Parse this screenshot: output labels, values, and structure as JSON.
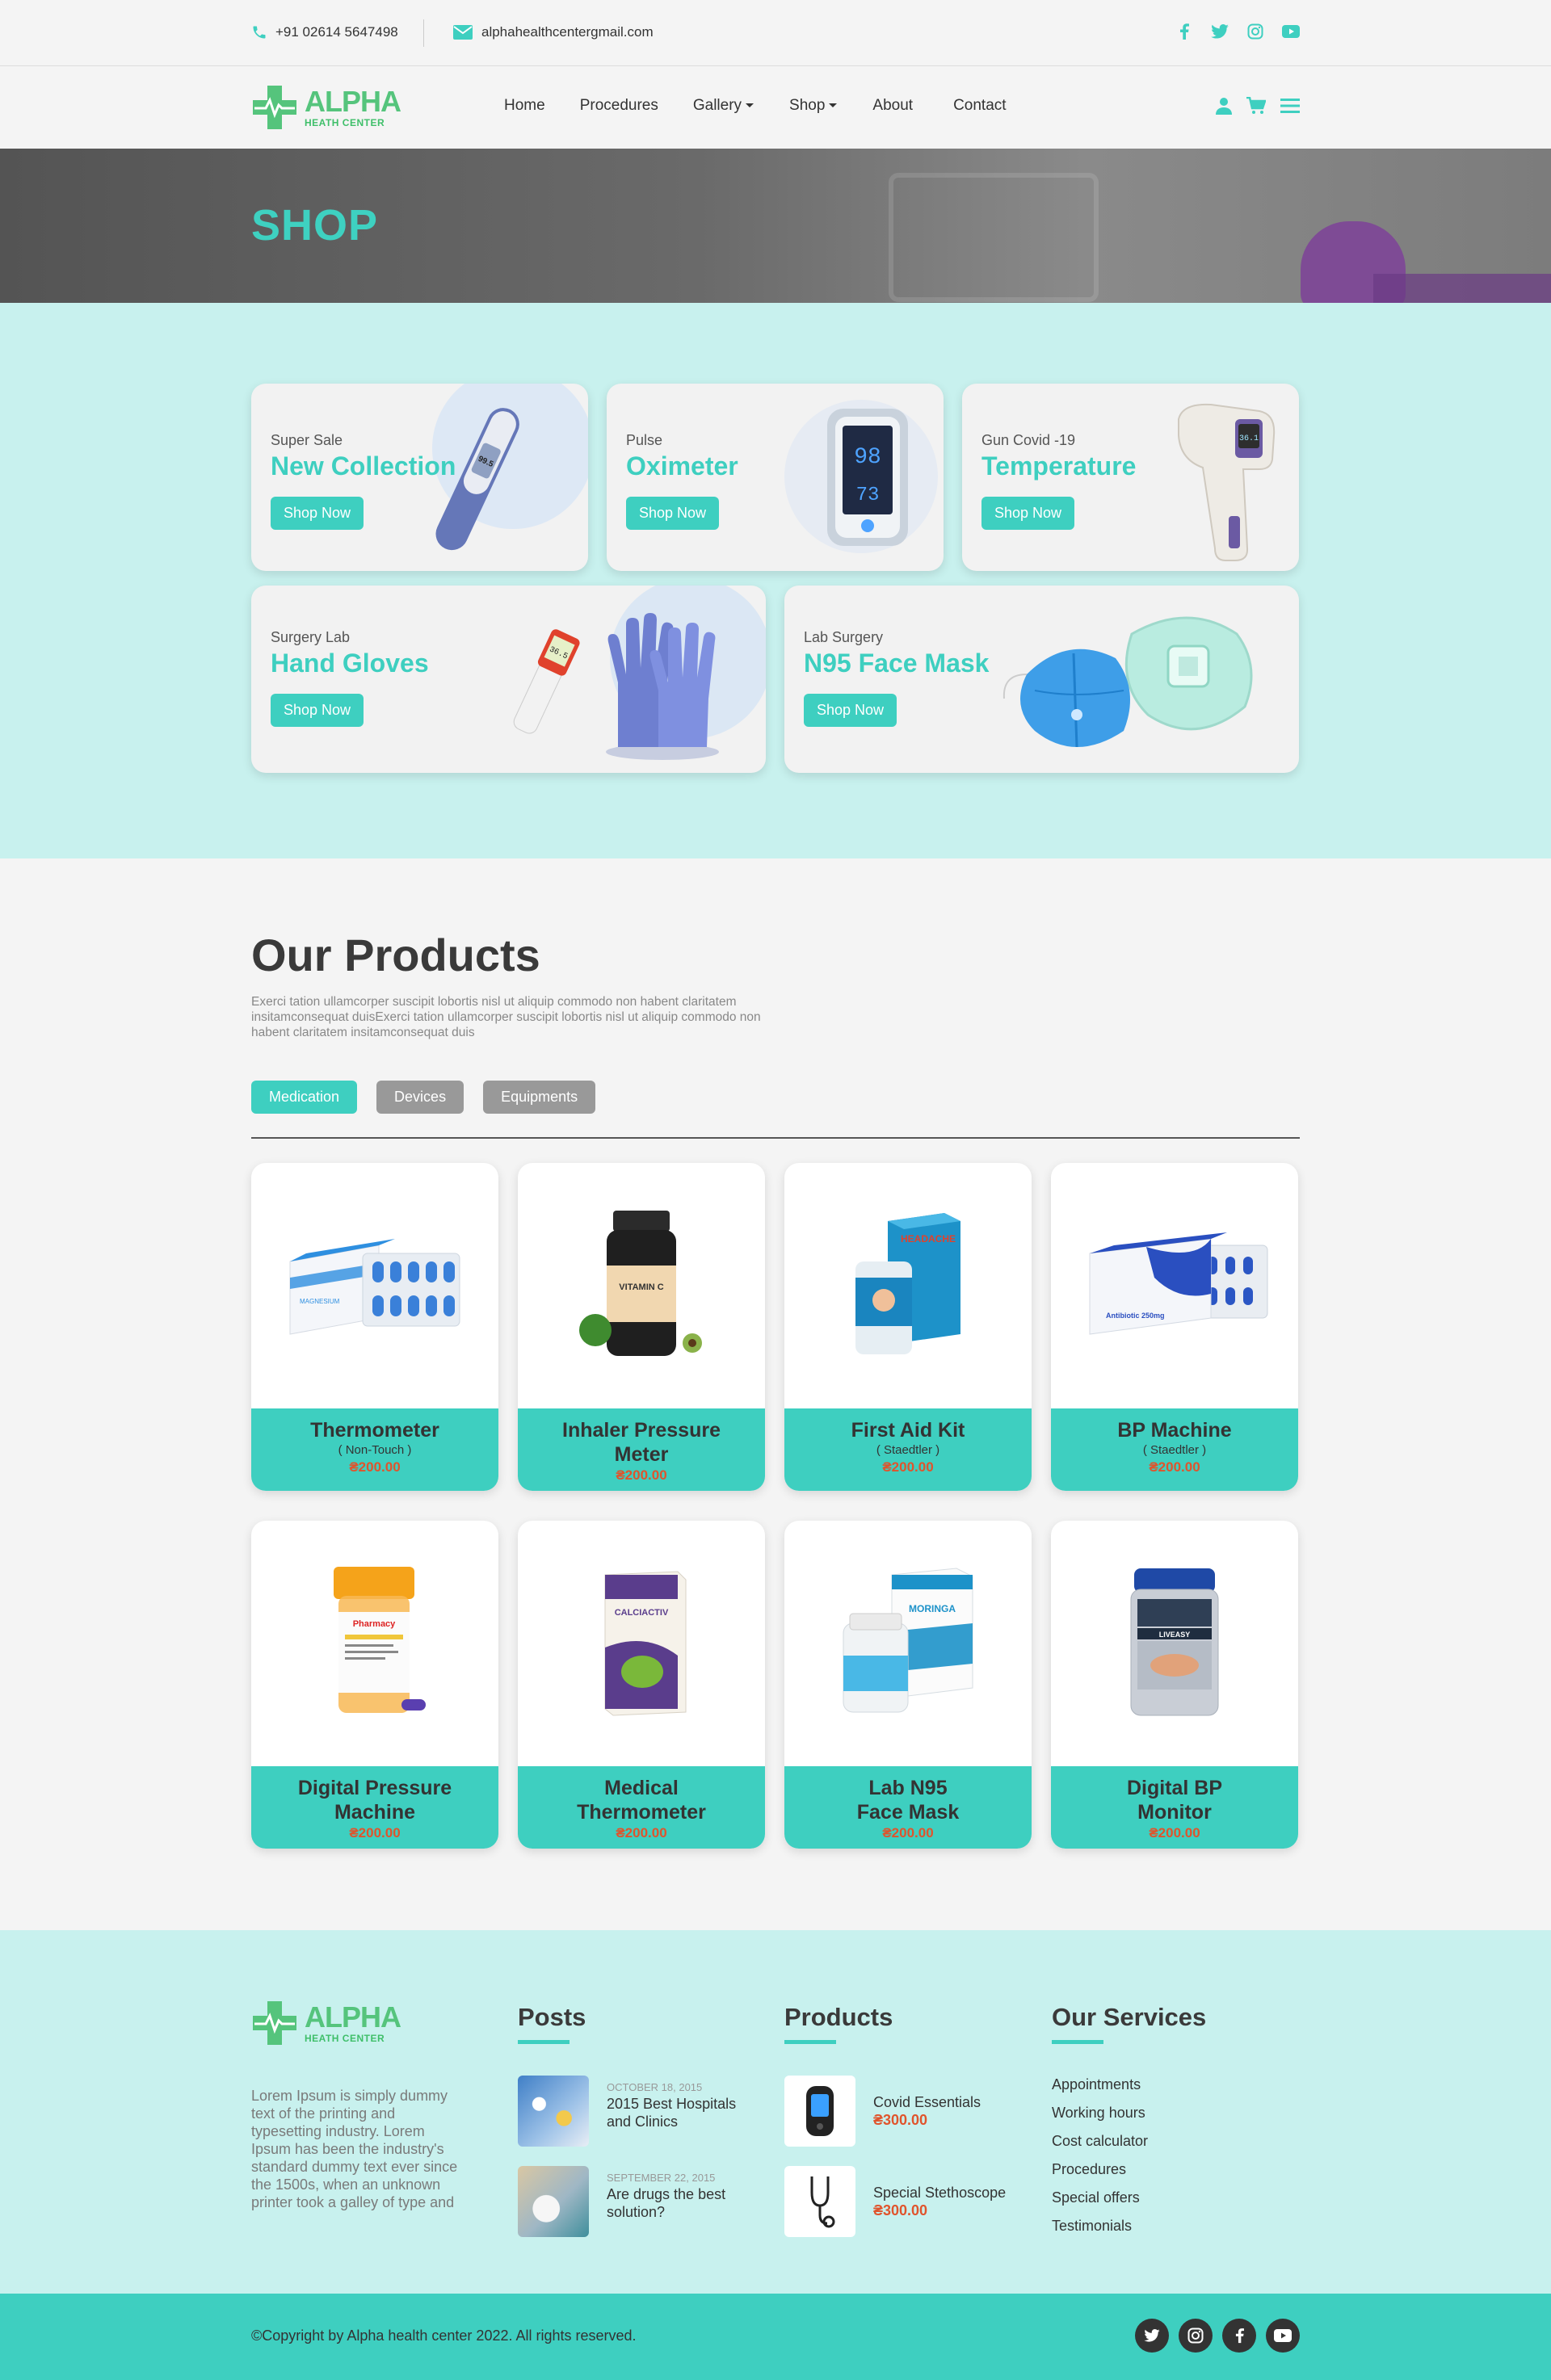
{
  "topbar": {
    "phone": "+91 02614 5647498",
    "email": "alphahealthcentergmail.com",
    "socials": [
      "facebook-icon",
      "twitter-icon",
      "instagram-icon",
      "youtube-icon"
    ]
  },
  "brand": {
    "name": "ALPHA",
    "tagline": "HEATH CENTER"
  },
  "nav": {
    "home": "Home",
    "procedures": "Procedures",
    "gallery": "Gallery",
    "shop": "Shop",
    "about": "About",
    "contact": "Contact"
  },
  "hero": {
    "title": "SHOP"
  },
  "promos": [
    {
      "sub": "Super Sale",
      "title": "New Collection",
      "button": "Shop Now",
      "display": "99.5"
    },
    {
      "sub": "Pulse",
      "title": "Oximeter",
      "button": "Shop Now",
      "display_top": "98",
      "display_bottom": "73"
    },
    {
      "sub": "Gun Covid -19",
      "title": "Temperature",
      "button": "Shop Now",
      "display": "36.1"
    },
    {
      "sub": "Surgery Lab",
      "title": "Hand Gloves",
      "button": "Shop Now",
      "display": "36.5"
    },
    {
      "sub": "Lab Surgery",
      "title": "N95 Face Mask",
      "button": "Shop Now"
    }
  ],
  "products_section": {
    "heading": "Our Products",
    "description": "Exerci tation ullamcorper suscipit lobortis nisl ut aliquip commodo non habent claritatem insitamconsequat duisExerci tation ullamcorper suscipit lobortis nisl ut aliquip commodo non habent claritatem insitamconsequat duis",
    "filters": [
      "Medication",
      "Devices",
      "Equipments"
    ]
  },
  "products": [
    {
      "name": "Thermometer",
      "sub": "( Non-Touch )",
      "price": "₴200.00",
      "pack_label": "MAGNESIUM"
    },
    {
      "name": "Inhaler Pressure Meter",
      "sub": "",
      "price": "₴200.00",
      "pack_label": "VITAMIN C"
    },
    {
      "name": "First Aid Kit",
      "sub": "( Staedtler )",
      "price": "₴200.00",
      "pack_label": "HEADACHE"
    },
    {
      "name": "BP Machine",
      "sub": "( Staedtler )",
      "price": "₴200.00",
      "pack_label": "Antibiotic 250mg"
    },
    {
      "name": "Digital Pressure Machine",
      "sub": "",
      "price": "₴200.00",
      "pack_label": "Pharmacy"
    },
    {
      "name": "Medical Thermometer",
      "sub": "",
      "price": "₴200.00",
      "pack_label": "CALCIACTIV"
    },
    {
      "name": "Lab N95 Face Mask",
      "sub": "",
      "price": "₴200.00",
      "pack_label": "MORINGA"
    },
    {
      "name": "Digital BP Monitor",
      "sub": "",
      "price": "₴200.00",
      "pack_label": "LIVEASY"
    }
  ],
  "footer": {
    "about": "Lorem Ipsum is simply dummy text of the printing and typesetting industry. Lorem Ipsum has been the industry's standard dummy text ever since the 1500s, when an unknown printer took a galley of type and",
    "posts_title": "Posts",
    "posts": [
      {
        "date": "OCTOBER 18, 2015",
        "title": "2015 Best Hospitals and Clinics"
      },
      {
        "date": "SEPTEMBER 22, 2015",
        "title": "Are drugs the best solution?"
      }
    ],
    "products_title": "Products",
    "products": [
      {
        "name": "Covid Essentials",
        "price": "₴300.00"
      },
      {
        "name": "Special Stethoscope",
        "price": "₴300.00"
      }
    ],
    "services_title": "Our Services",
    "services": [
      "Appointments",
      "Working hours",
      "Cost calculator",
      "Procedures",
      "Special offers",
      "Testimonials"
    ]
  },
  "bottombar": {
    "copyright": "Copyright by Alpha health center 2022. All rights reserved."
  },
  "colors": {
    "accent": "#3ecfc0",
    "price": "#e0542c",
    "brand_green": "#55c47c",
    "light_bg": "#c8f1ee"
  }
}
